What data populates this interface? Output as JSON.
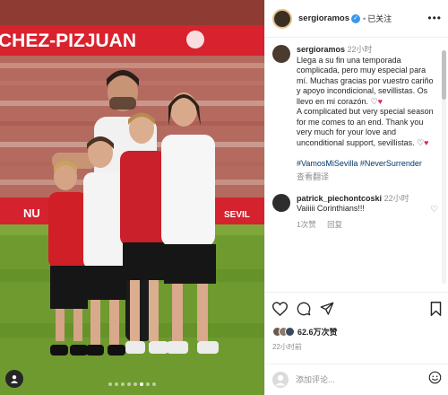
{
  "photo": {
    "banner_text": "CHEZ-PIZJUAN",
    "board_text": "NU",
    "board_text_right": "SEVIL",
    "carousel_total": 8,
    "carousel_active": 5
  },
  "header": {
    "username": "sergioramos",
    "verified_mark": "✓",
    "separator": "•",
    "follow_label": "已关注",
    "more_label": "•••"
  },
  "caption": {
    "username": "sergioramos",
    "time": "22小时",
    "spanish": "Llega a su fin una temporada complicada, pero muy especial para mí. Muchas gracias por vuestro cariño y apoyo incondicional, sevillistas. Os llevo en mi corazón.",
    "english": "A complicated but very special season for me comes to an end. Thank you very much for your love and unconditional support, sevillistas.",
    "heart_outline": "♡",
    "heart_red": "♥",
    "hashtags": "#VamosMiSevilla #NeverSurrender",
    "translate": "查看翻译"
  },
  "comment": {
    "username": "patrick_piechontcoski",
    "time": "22小时",
    "text": "Vaiiiii Corinthians!!!",
    "likes": "1次赞",
    "reply": "回复",
    "heart": "♡"
  },
  "actions": {
    "likes": "62.6万次赞",
    "time": "22小时前"
  },
  "add_comment": {
    "placeholder": "添加评论..."
  }
}
